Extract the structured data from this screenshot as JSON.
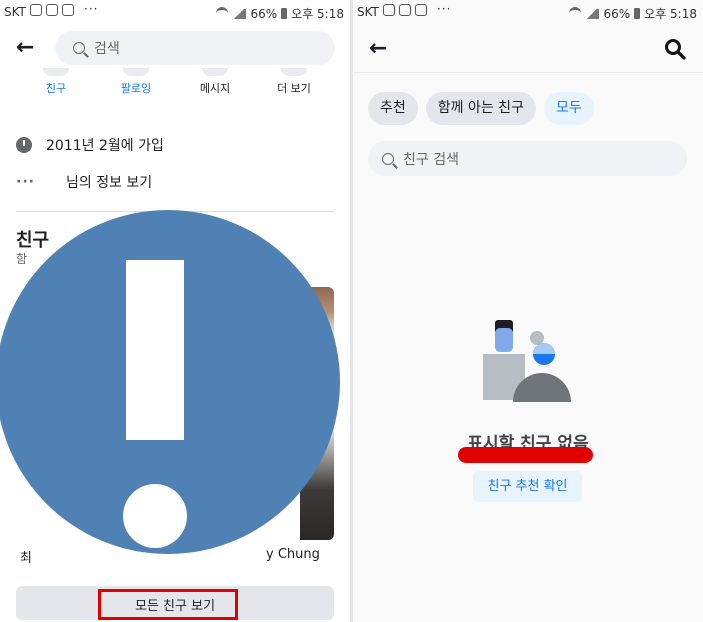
{
  "left": {
    "status": {
      "carrier": "SKT",
      "battery": "66%",
      "time": "오후 5:18"
    },
    "search_placeholder": "검색",
    "tabs": [
      {
        "label": "친구",
        "color": "#1877f2"
      },
      {
        "label": "팔로잉",
        "color": "#1877f2"
      },
      {
        "label": "메시지",
        "color": "#1c1e21"
      },
      {
        "label": "더 보기",
        "color": "#1c1e21"
      }
    ],
    "joined": "2011년 2월에 가입",
    "profile_info": "님의 정보 보기",
    "friends_title": "친구",
    "friends_sub_fragment": "함",
    "captions": [
      "최",
      "y Chung"
    ],
    "see_all": "모든 친구 보기"
  },
  "right": {
    "status": {
      "carrier": "SKT",
      "battery": "66%",
      "time": "오후 5:18"
    },
    "chips": [
      {
        "label": "추천",
        "active": false
      },
      {
        "label": "함께 아는 친구",
        "active": false
      },
      {
        "label": "모두",
        "active": true
      }
    ],
    "search_placeholder": "친구 검색",
    "empty_title": "표시할 친구 없음",
    "suggest_button": "친구 추천 확인"
  },
  "colors": {
    "fb_blue": "#1877f2",
    "highlight_red": "#e00000",
    "alert_blue": "#4f81b5"
  }
}
